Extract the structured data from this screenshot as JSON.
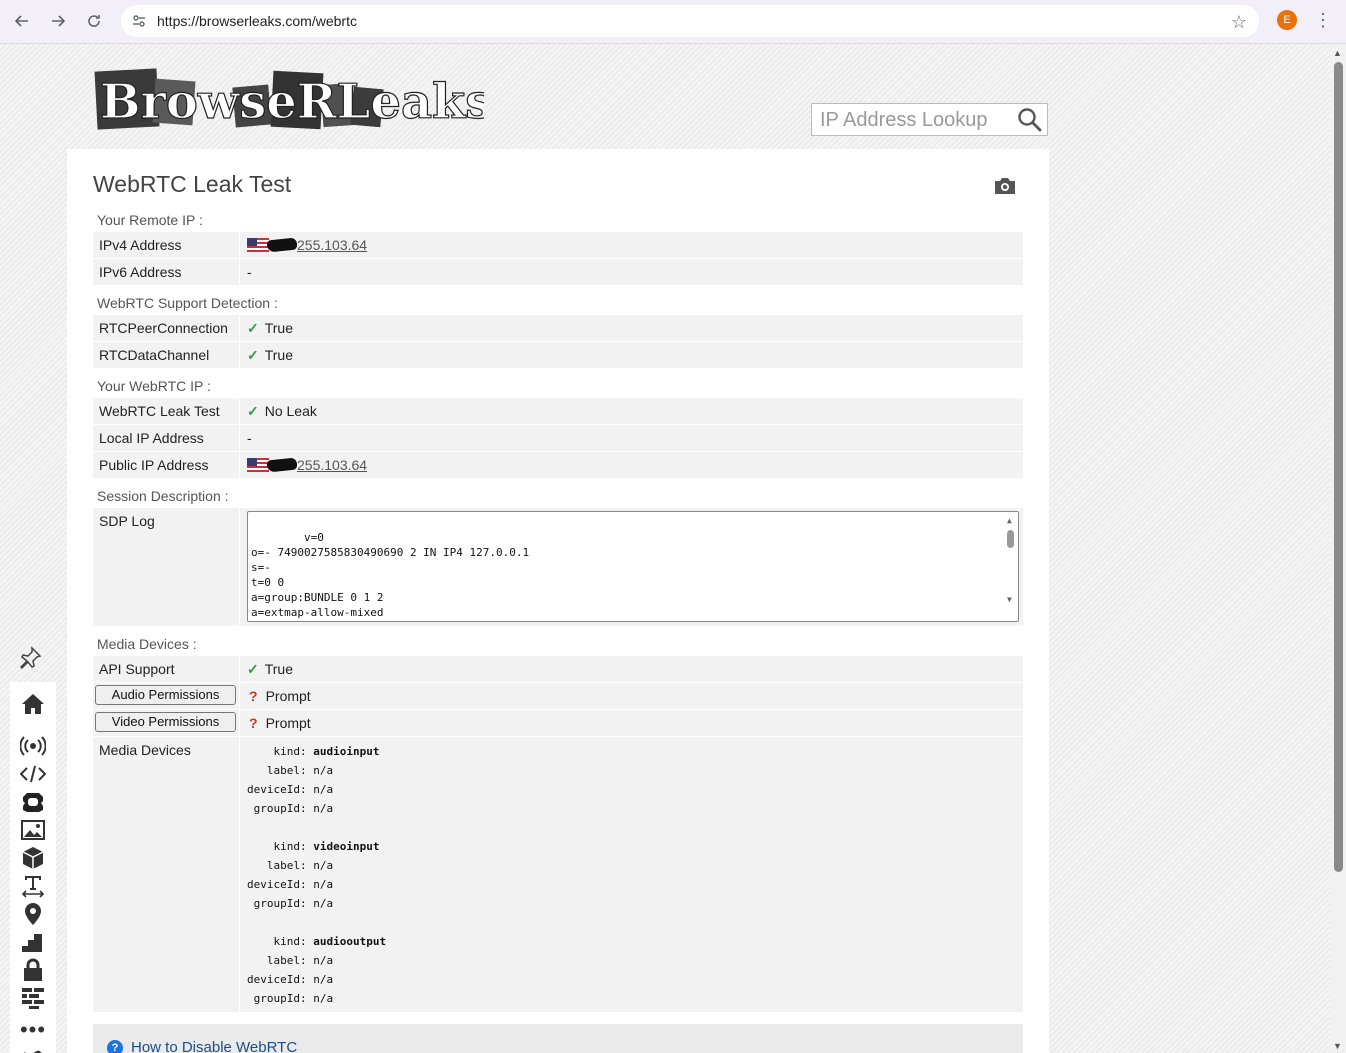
{
  "browser": {
    "url": "https://browserleaks.com/webrtc",
    "profile_initial": "E"
  },
  "header": {
    "logo_text": "BrowseRLeaks.com",
    "search_placeholder": "IP Address Lookup"
  },
  "page": {
    "title": "WebRTC Leak Test"
  },
  "sections": {
    "remote_ip": {
      "title": "Your Remote IP :",
      "ipv4_label": "IPv4 Address",
      "ipv4_value": "255.103.64",
      "ipv6_label": "IPv6 Address",
      "ipv6_value": "-"
    },
    "support": {
      "title": "WebRTC Support Detection :",
      "peer_label": "RTCPeerConnection",
      "peer_value": "True",
      "channel_label": "RTCDataChannel",
      "channel_value": "True"
    },
    "webrtc_ip": {
      "title": "Your WebRTC IP :",
      "leak_label": "WebRTC Leak Test",
      "leak_value": "No Leak",
      "local_label": "Local IP Address",
      "local_value": "-",
      "public_label": "Public IP Address",
      "public_value": "255.103.64"
    },
    "session": {
      "title": "Session Description :",
      "sdp_label": "SDP Log",
      "sdp_log": "v=0\no=- 7490027585830490690 2 IN IP4 127.0.0.1\ns=-\nt=0 0\na=group:BUNDLE 0 1 2\na=extmap-allow-mixed\na=msid-semantic: WMS"
    },
    "media": {
      "title": "Media Devices :",
      "api_label": "API Support",
      "api_value": "True",
      "audio_button": "Audio Permissions",
      "audio_value": "Prompt",
      "video_button": "Video Permissions",
      "video_value": "Prompt",
      "devices_label": "Media Devices",
      "devices": [
        {
          "kind": "audioinput",
          "label": "n/a",
          "deviceId": "n/a",
          "groupId": "n/a"
        },
        {
          "kind": "videoinput",
          "label": "n/a",
          "deviceId": "n/a",
          "groupId": "n/a"
        },
        {
          "kind": "audiooutput",
          "label": "n/a",
          "deviceId": "n/a",
          "groupId": "n/a"
        }
      ],
      "keys": {
        "kind": "kind:",
        "label": "label:",
        "deviceId": "deviceId:",
        "groupId": "groupId:"
      }
    }
  },
  "footer_help": {
    "link_text": "How to Disable WebRTC",
    "icon": "question-circle-icon"
  },
  "dock_icons": [
    "home-icon",
    "broadcast-icon",
    "code-icon",
    "blob-icon",
    "image-icon",
    "cube-icon",
    "text-width-icon",
    "map-pin-icon",
    "stairs-icon",
    "lock-icon",
    "bricks-icon",
    "more-dots-icon",
    "tools-icon"
  ],
  "colors": {
    "check_green": "#2a9d3a",
    "question_red": "#c0392b",
    "row_bg": "#f2f2f2"
  }
}
